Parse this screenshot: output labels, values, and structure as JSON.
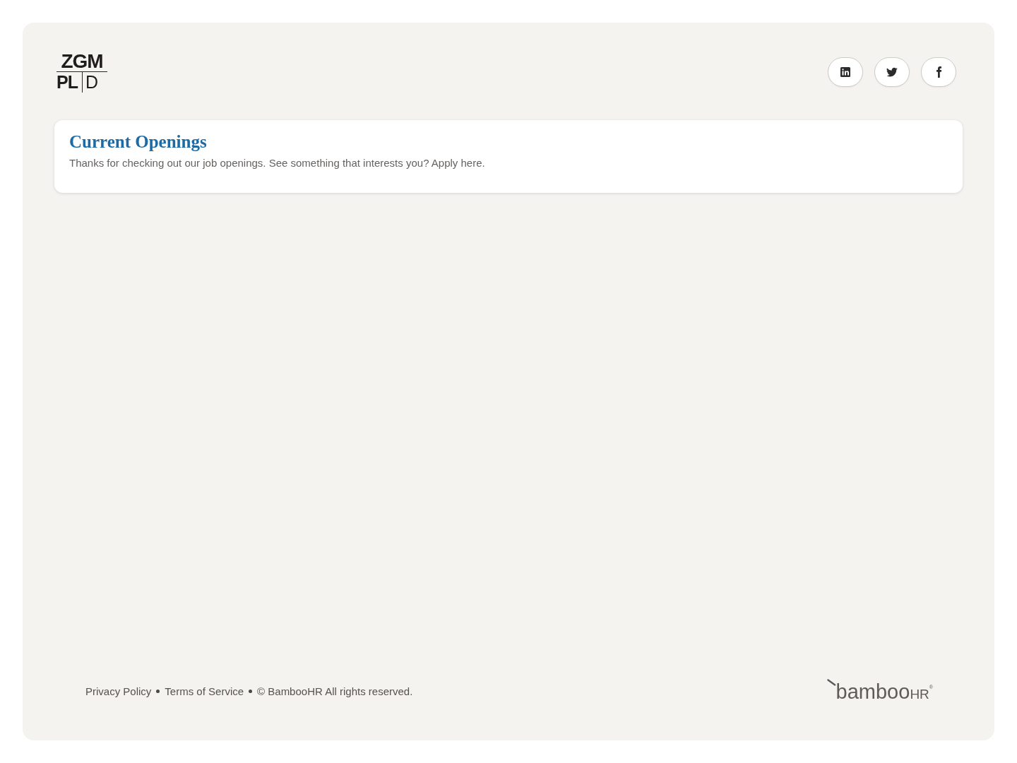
{
  "logo": {
    "top": "ZGM",
    "bottom_left": "PL",
    "bottom_right": "D"
  },
  "social_links": [
    {
      "kind": "linkedin"
    },
    {
      "kind": "twitter"
    },
    {
      "kind": "facebook"
    }
  ],
  "openings": {
    "title": "Current Openings",
    "intro": "Thanks for checking out our job openings. See something that interests you? Apply here."
  },
  "footer": {
    "links": [
      "Privacy Policy",
      "Terms of Service"
    ],
    "copyright": "© BambooHR All rights reserved.",
    "logo": {
      "name": "bamboo",
      "suffix": "HR",
      "mark": "®"
    }
  }
}
